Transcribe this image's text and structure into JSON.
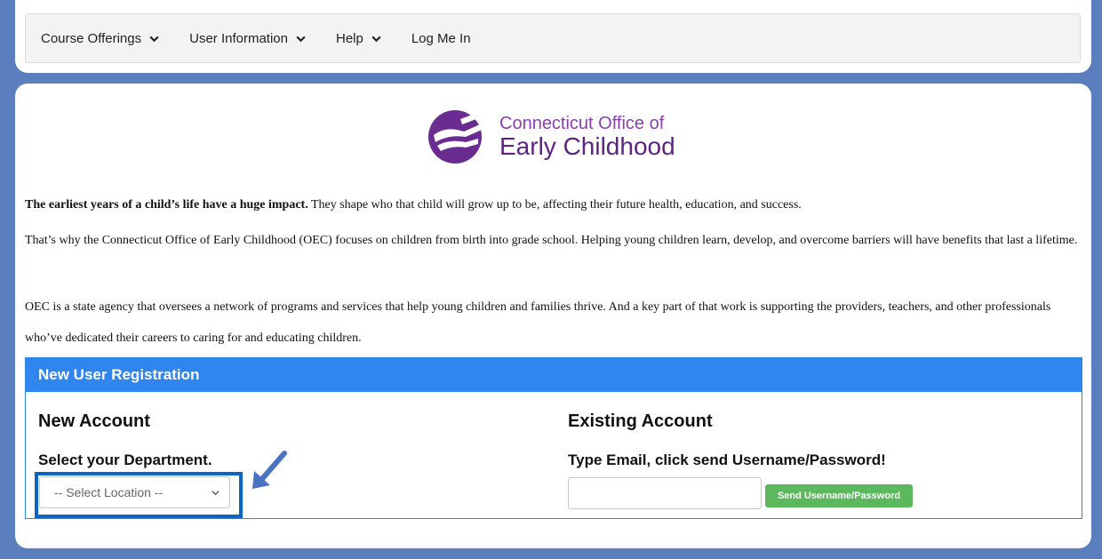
{
  "nav": {
    "items": [
      {
        "label": "Course Offerings",
        "icon": "chevron-down-icon"
      },
      {
        "label": "User Information",
        "icon": "chevron-down-icon"
      },
      {
        "label": "Help",
        "icon": "chevron-down-icon"
      },
      {
        "label": "Log Me In"
      }
    ]
  },
  "logo": {
    "line1": "Connecticut Office of",
    "line2": "Early Childhood",
    "colors": {
      "purple_light": "#8a3fb0",
      "purple_dark": "#5c2483"
    }
  },
  "intro": {
    "p1_bold": "The earliest years of a child’s life have a huge impact.",
    "p1_rest": " They shape who that child will grow up to be, affecting their future health, education, and success.",
    "p2": "That’s why the Connecticut Office of Early Childhood (OEC) focuses on children from birth into grade school. Helping young children learn, develop, and overcome barriers will have benefits that last a lifetime.",
    "p3": "OEC is a state agency that oversees a network of programs and services that help young children and families thrive. And a key part of that work is supporting the providers, teachers, and other professionals who’ve dedicated their careers to caring for and educating children."
  },
  "registration": {
    "header": "New User Registration",
    "new_account": {
      "title": "New Account",
      "subtitle": "Select your Department.",
      "select_value": "-- Select Location --"
    },
    "existing_account": {
      "title": "Existing Account",
      "subtitle": "Type Email, click send Username/Password!",
      "email_value": "",
      "button_label": "Send Username/Password"
    }
  },
  "colors": {
    "background": "#5b7fbe",
    "panel_header": "#2f86ee",
    "button": "#5cb85c",
    "highlight": "#0a66c2"
  }
}
